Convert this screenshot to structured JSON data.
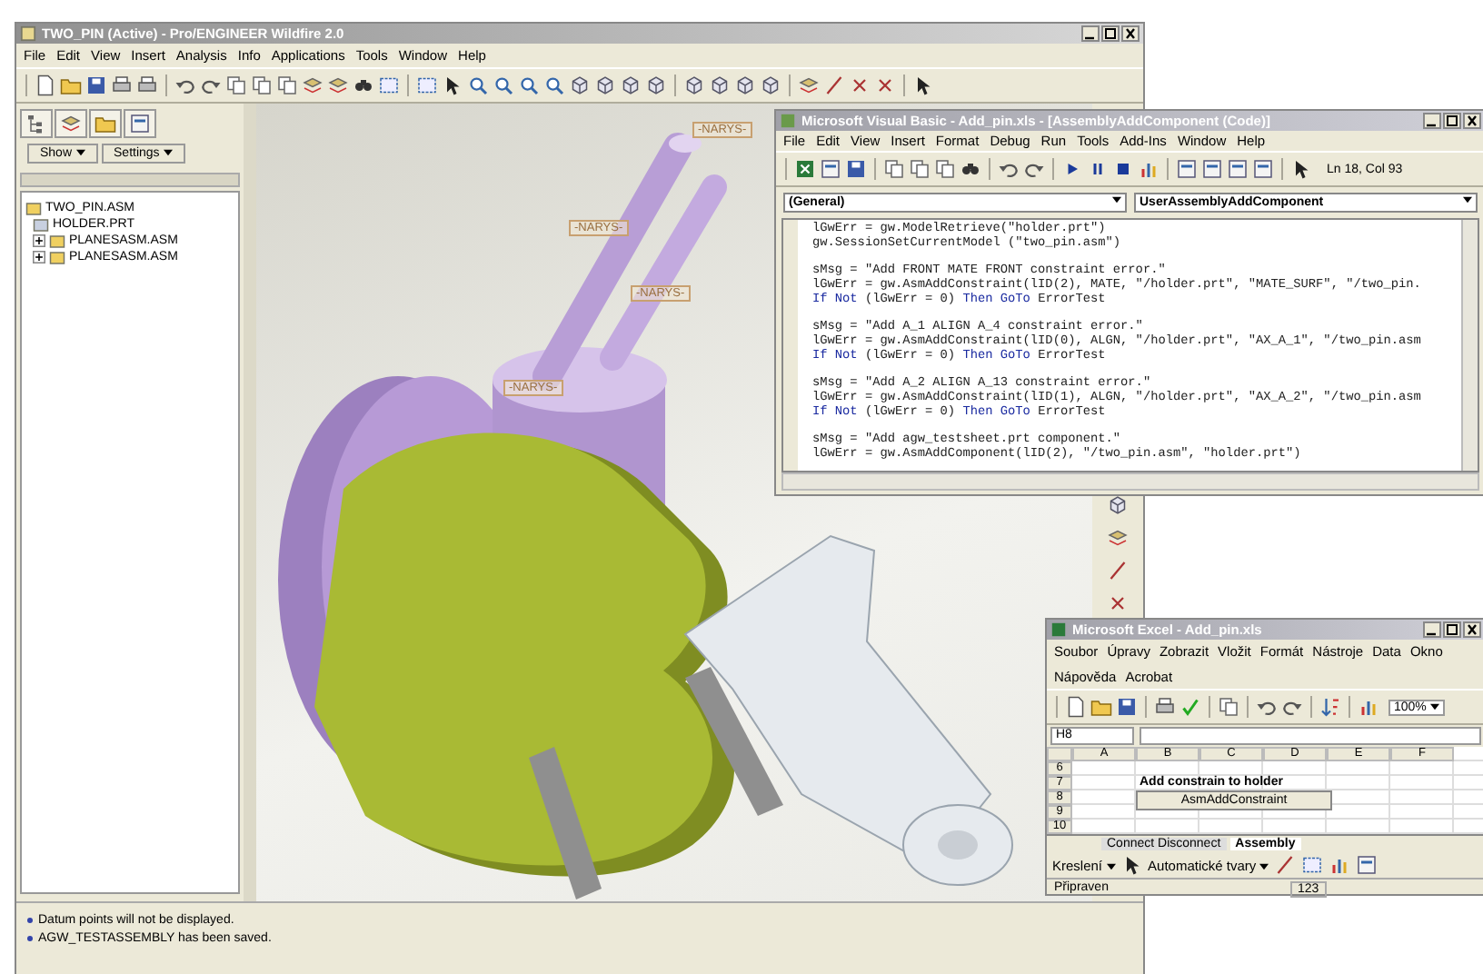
{
  "proe": {
    "title": "TWO_PIN (Active) - Pro/ENGINEER Wildfire 2.0",
    "menu": [
      "File",
      "Edit",
      "View",
      "Insert",
      "Analysis",
      "Info",
      "Applications",
      "Tools",
      "Window",
      "Help"
    ],
    "panel_buttons": [
      "Show",
      "Settings"
    ],
    "tree": [
      {
        "label": "TWO_PIN.ASM",
        "children": [
          {
            "label": "HOLDER.PRT"
          },
          {
            "label": "PLANESASM.ASM",
            "expanded": false
          },
          {
            "label": "PLANESASM.ASM",
            "expanded": false
          }
        ]
      }
    ],
    "annotations": [
      "-NARYS-",
      "-NARYS-",
      "-NARYS-",
      "-NARYS-"
    ],
    "messages": [
      "Datum points will not be displayed.",
      "AGW_TESTASSEMBLY has been saved."
    ]
  },
  "vb": {
    "title": "Microsoft Visual Basic - Add_pin.xls - [AssemblyAddComponent (Code)]",
    "menu": [
      "File",
      "Edit",
      "View",
      "Insert",
      "Format",
      "Debug",
      "Run",
      "Tools",
      "Add-Ins",
      "Window",
      "Help"
    ],
    "position": "Ln 18, Col 93",
    "object": "(General)",
    "procedure": "UserAssemblyAddComponent",
    "blocks": [
      [
        [
          {
            "text": "lGwErr = gw.ModelRetrieve(\"holder.prt\")",
            "keyword": false
          }
        ],
        [
          {
            "text": "gw.SessionSetCurrentModel (\"two_pin.asm\")",
            "keyword": false
          }
        ]
      ],
      [
        [
          {
            "text": "sMsg = \"Add FRONT MATE FRONT constraint error.\"",
            "keyword": false
          }
        ],
        [
          {
            "text": "lGwErr = gw.AsmAddConstraint(lID(2), MATE, \"/holder.prt\", \"MATE_SURF\", \"/two_pin.",
            "keyword": false
          }
        ],
        [
          {
            "text": "If Not",
            "keyword": true
          },
          {
            "text": " (lGwErr = 0) ",
            "keyword": false
          },
          {
            "text": "Then GoTo",
            "keyword": true
          },
          {
            "text": " ErrorTest",
            "keyword": false
          }
        ]
      ],
      [
        [
          {
            "text": "sMsg = \"Add A_1 ALIGN A_4 constraint error.\"",
            "keyword": false
          }
        ],
        [
          {
            "text": "lGwErr = gw.AsmAddConstraint(lID(0), ALGN, \"/holder.prt\", \"AX_A_1\", \"/two_pin.asm",
            "keyword": false
          }
        ],
        [
          {
            "text": "If Not",
            "keyword": true
          },
          {
            "text": " (lGwErr = 0) ",
            "keyword": false
          },
          {
            "text": "Then GoTo",
            "keyword": true
          },
          {
            "text": " ErrorTest",
            "keyword": false
          }
        ]
      ],
      [
        [
          {
            "text": "sMsg = \"Add A_2 ALIGN A_13 constraint error.\"",
            "keyword": false
          }
        ],
        [
          {
            "text": "lGwErr = gw.AsmAddConstraint(lID(1), ALGN, \"/holder.prt\", \"AX_A_2\", \"/two_pin.asm",
            "keyword": false
          }
        ],
        [
          {
            "text": "If Not",
            "keyword": true
          },
          {
            "text": " (lGwErr = 0) ",
            "keyword": false
          },
          {
            "text": "Then GoTo",
            "keyword": true
          },
          {
            "text": " ErrorTest",
            "keyword": false
          }
        ]
      ],
      [
        [
          {
            "text": "sMsg = \"Add agw_testsheet.prt component.\"",
            "keyword": false
          }
        ],
        [
          {
            "text": "lGwErr = gw.AsmAddComponent(lID(2), \"/two_pin.asm\", \"holder.prt\")",
            "keyword": false
          }
        ]
      ]
    ]
  },
  "excel": {
    "title": "Microsoft Excel - Add_pin.xls",
    "menu": [
      "Soubor",
      "Úpravy",
      "Zobrazit",
      "Vložit",
      "Formát",
      "Nástroje",
      "Data",
      "Okno",
      "Nápověda",
      "Acrobat"
    ],
    "name_box": "H8",
    "zoom": "100%",
    "columns": [
      "A",
      "B",
      "C",
      "D",
      "E",
      "F"
    ],
    "rows": [
      "6",
      "7",
      "8",
      "9",
      "10"
    ],
    "heading": "Add constrain to holder",
    "macro_button": "AsmAddConstraint",
    "sheet_tabs": [
      {
        "label": "Connect Disconnect",
        "selected": false
      },
      {
        "label": "Assembly",
        "selected": true
      }
    ],
    "draw_menu": "Kreslení",
    "autoshapes_menu": "Automatické tvary",
    "status": "Připraven",
    "indicator": "123"
  }
}
